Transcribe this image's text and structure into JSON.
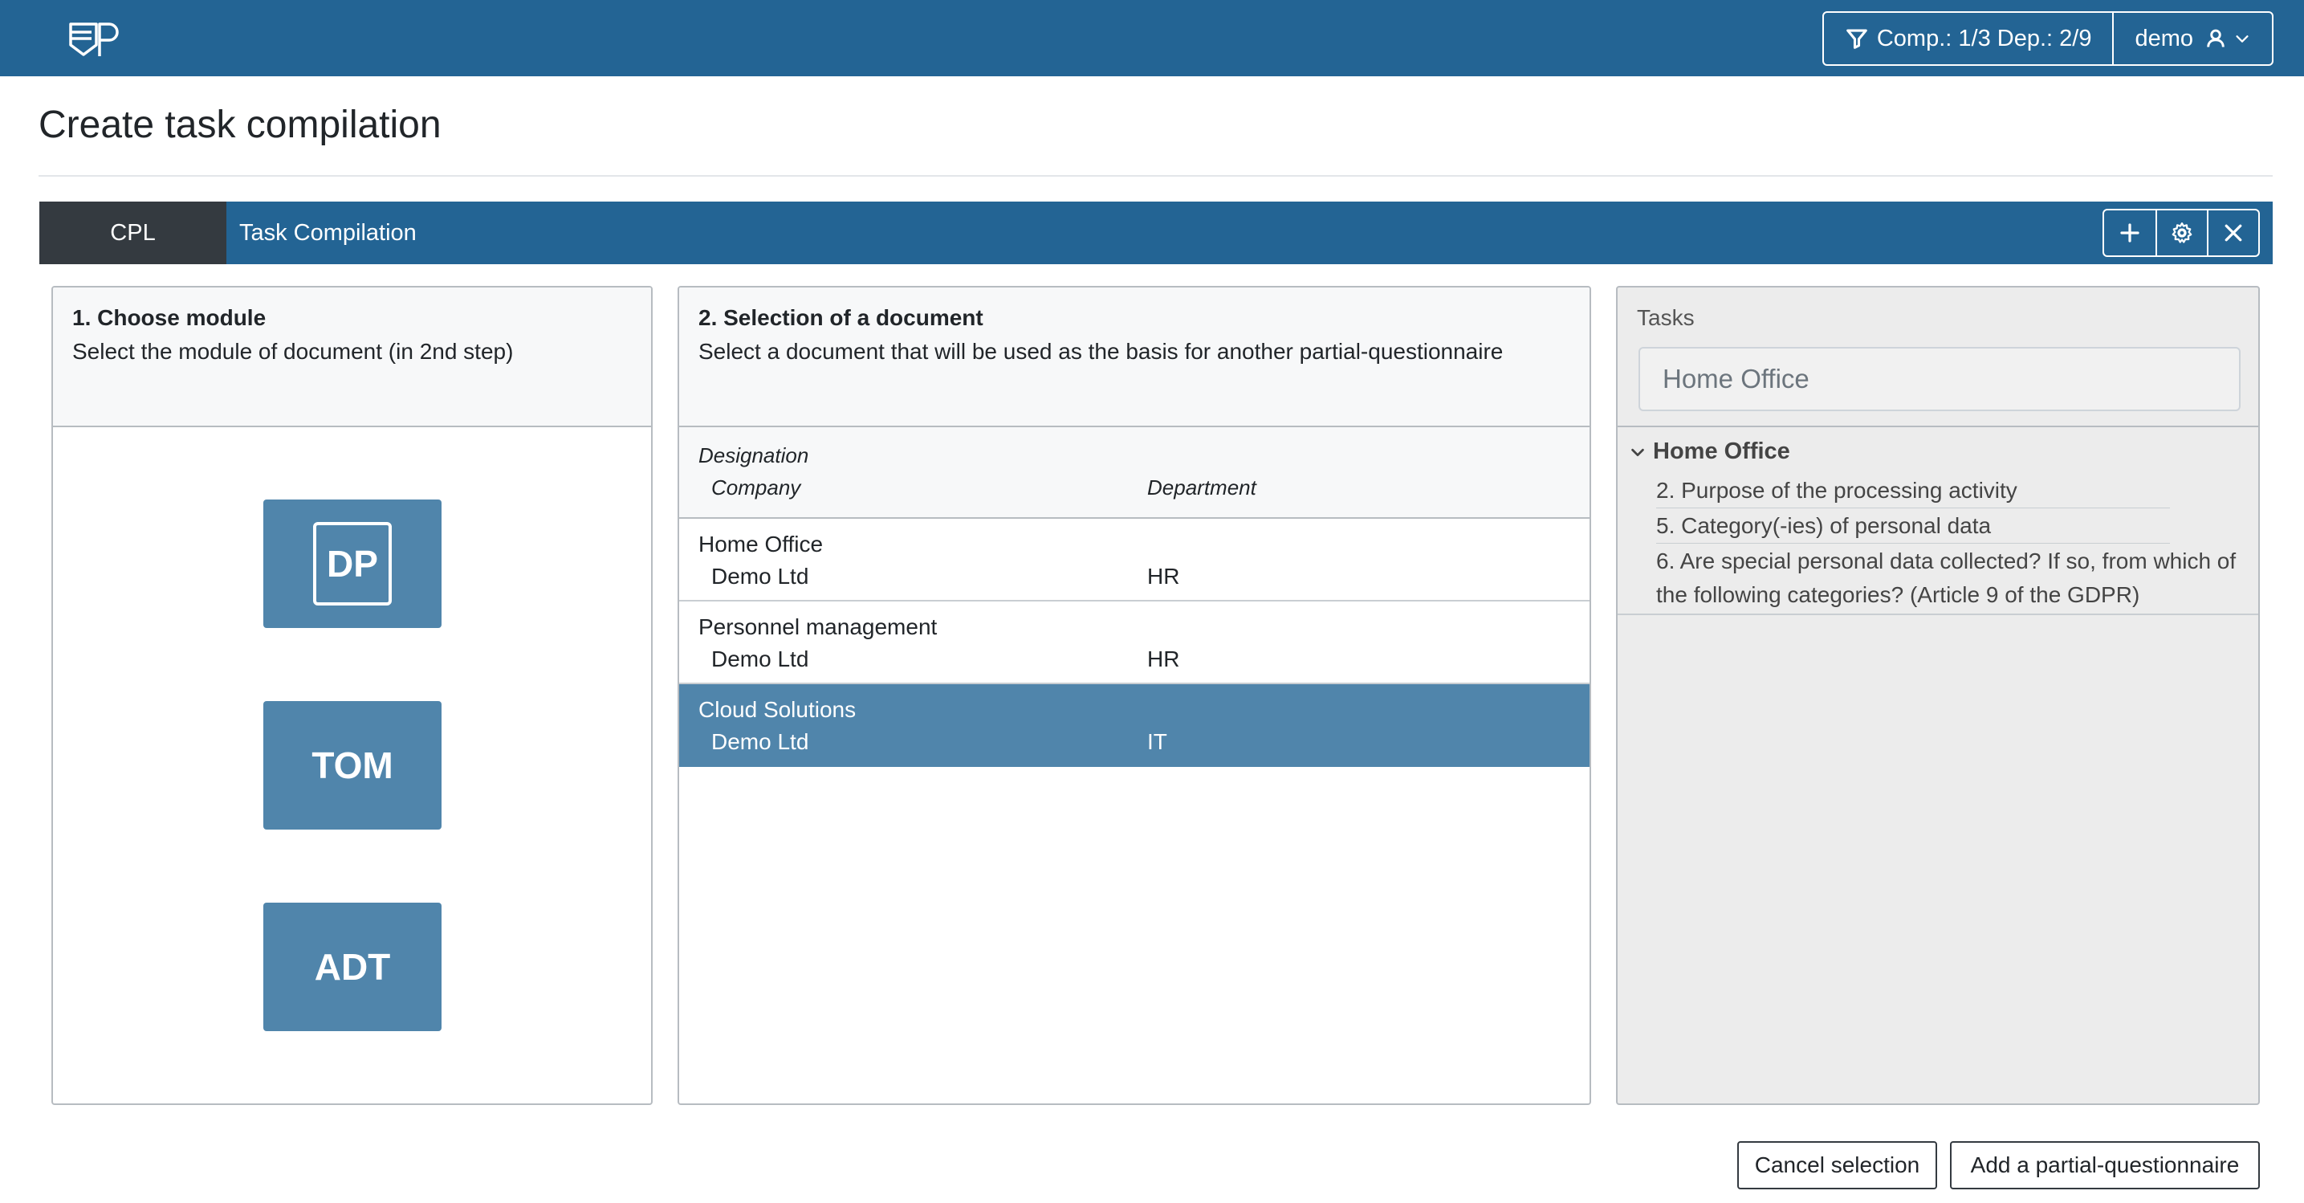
{
  "app": {
    "logo_text": "EP"
  },
  "header": {
    "filter_label": "Comp.: 1/3 Dep.: 2/9",
    "user_label": "demo"
  },
  "page": {
    "title": "Create task compilation"
  },
  "tabs": {
    "cpl_label": "CPL",
    "active_label": "Task Compilation"
  },
  "panel_module": {
    "heading": "1. Choose module",
    "subtext": "Select the module of document (in 2nd step)",
    "modules": [
      "DP",
      "TOM",
      "ADT"
    ]
  },
  "panel_document": {
    "heading": "2. Selection of a document",
    "subtext": "Select a document that will be used as the basis for another partial-questionnaire",
    "columns": {
      "designation": "Designation",
      "company": "Company",
      "department": "Department"
    },
    "rows": [
      {
        "designation": "Home Office",
        "company": "Demo Ltd",
        "department": "HR"
      },
      {
        "designation": "Personnel management",
        "company": "Demo Ltd",
        "department": "HR"
      },
      {
        "designation": "Cloud Solutions",
        "company": "Demo Ltd",
        "department": "IT"
      }
    ]
  },
  "panel_tasks": {
    "label": "Tasks",
    "input_value": "Home Office",
    "group_title": "Home Office",
    "items": [
      "2. Purpose of the processing activity",
      "5. Category(-ies) of personal data",
      "6. Are special personal data collected? If so, from which of the following categories? (Article 9 of the GDPR)"
    ]
  },
  "footer": {
    "cancel_label": "Cancel selection",
    "add_label": "Add a partial-questionnaire"
  },
  "colors": {
    "primary": "#236494",
    "dark_tab": "#343a40",
    "module_button": "#5085ab",
    "selected_row": "#5085ab"
  }
}
